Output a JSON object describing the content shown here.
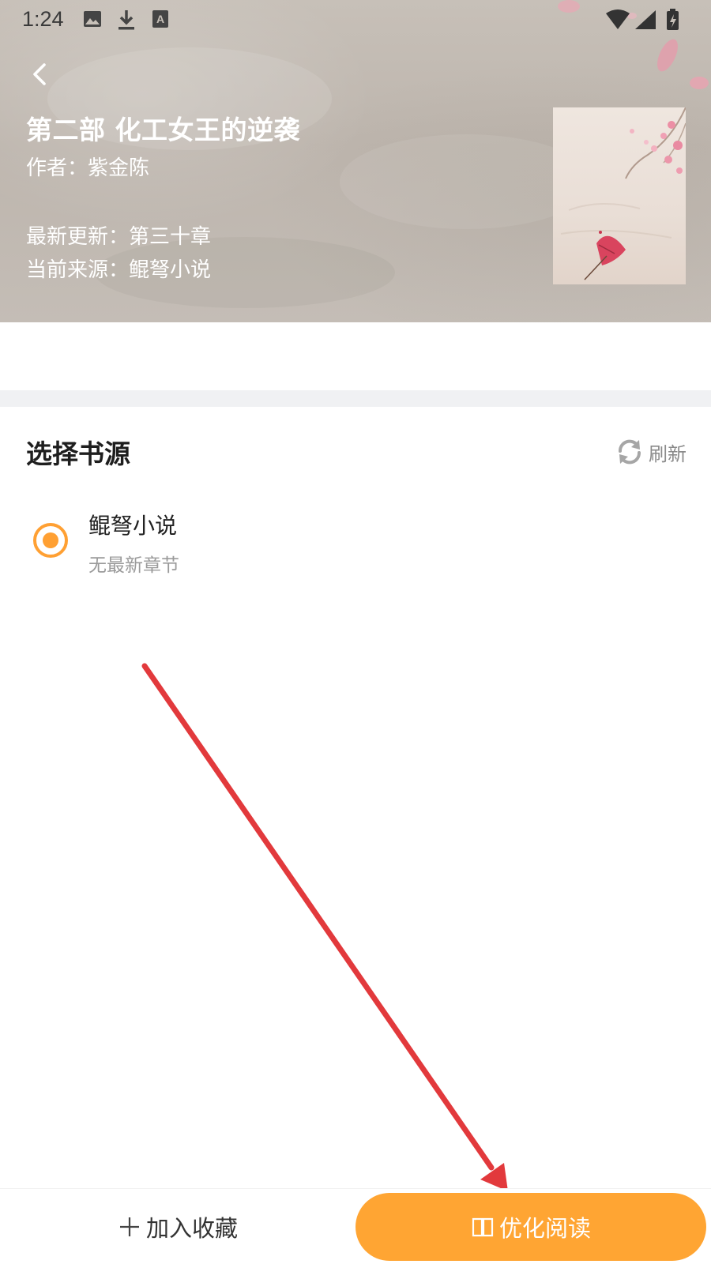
{
  "status_bar": {
    "time": "1:24",
    "icons": [
      "image-icon",
      "download-icon",
      "keyboard-a-icon",
      "wifi-icon",
      "signal-icon",
      "battery-icon"
    ]
  },
  "header": {
    "back_icon": "chevron-left-icon",
    "title": "第二部 化工女王的逆袭",
    "author": "作者：紫金陈",
    "latest_update": "最新更新：第三十章",
    "current_source": "当前来源：鲲弩小说"
  },
  "source_section": {
    "title": "选择书源",
    "refresh_label": "刷新",
    "refresh_icon": "refresh-icon",
    "items": [
      {
        "name": "鲲弩小说",
        "subtitle": "无最新章节",
        "selected": true
      }
    ]
  },
  "bottom_bar": {
    "collect_label": "加入收藏",
    "collect_icon": "plus-icon",
    "read_label": "优化阅读",
    "read_icon": "book-icon"
  },
  "colors": {
    "accent": "#ffa533",
    "annotation_arrow": "#e2393c",
    "hero_background": "#c2bbb3",
    "divider": "#f0f1f3"
  }
}
